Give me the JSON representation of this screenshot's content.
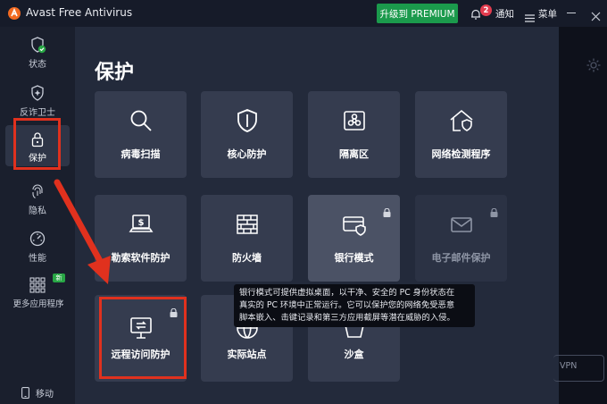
{
  "titlebar": {
    "app_name": "Avast Free Antivirus",
    "upgrade_label": "升级到 PREMIUM",
    "notification_count": "2",
    "notification_label": "通知",
    "menu_label": "菜单"
  },
  "sidebar": {
    "items": [
      {
        "label": "状态",
        "icon": "shield-check-icon"
      },
      {
        "label": "反诈卫士",
        "icon": "shield-sparkle-icon"
      },
      {
        "label": "保护",
        "icon": "lock-icon",
        "active": true
      },
      {
        "label": "隐私",
        "icon": "fingerprint-icon"
      },
      {
        "label": "性能",
        "icon": "gauge-icon"
      },
      {
        "label": "更多应用程序",
        "icon": "apps-grid-icon",
        "badge": "新"
      }
    ],
    "mobile_label": "移动"
  },
  "main": {
    "title": "保护",
    "tiles": [
      {
        "label": "病毒扫描",
        "icon": "magnifier-icon"
      },
      {
        "label": "核心防护",
        "icon": "shield-icon"
      },
      {
        "label": "隔离区",
        "icon": "biohazard-box-icon"
      },
      {
        "label": "网络检测程序",
        "icon": "home-shield-icon"
      },
      {
        "label": "勒索软件防护",
        "icon": "ransom-laptop-icon"
      },
      {
        "label": "防火墙",
        "icon": "firewall-icon"
      },
      {
        "label": "银行模式",
        "icon": "card-shield-icon",
        "locked": true
      },
      {
        "label": "电子邮件保护",
        "icon": "envelope-icon",
        "locked": true,
        "dimmed": true
      },
      {
        "label": "远程访问防护",
        "icon": "remote-monitor-icon",
        "locked": true
      },
      {
        "label": "实际站点",
        "icon": "globe-icon"
      },
      {
        "label": "沙盒",
        "icon": "sandbox-icon"
      }
    ],
    "tooltip": {
      "line1": "银行模式可提供虚拟桌面，以干净、安全的 PC 身份状态在",
      "line2": "真实的 PC 环境中正常运行。它可以保护您的网络免受恶意",
      "line3": "脚本嵌入、击键记录和第三方应用截屏等潜在威胁的入侵。"
    }
  },
  "right_strip": {
    "vpn_label": "VPN"
  },
  "colors": {
    "accent_green": "#1b9a4c",
    "highlight_red": "#e0311e",
    "badge_red": "#e23c4f",
    "tile_bg": "#353c4f"
  }
}
